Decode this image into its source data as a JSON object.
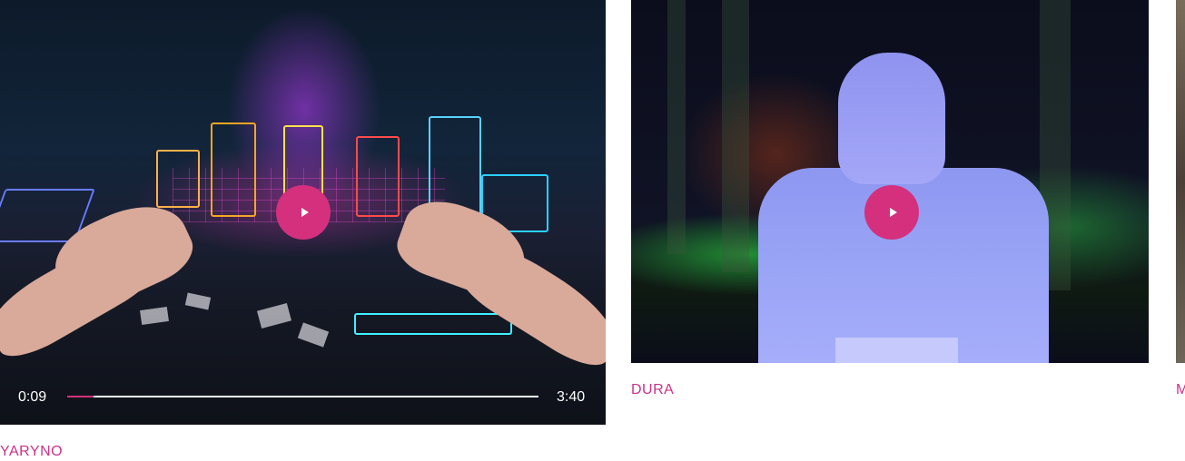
{
  "cards": [
    {
      "title": "YARYNO",
      "player": {
        "current_time": "0:09",
        "duration": "3:40",
        "progress_fraction": 0.055
      }
    },
    {
      "title": "DURA"
    },
    {
      "title": "M"
    }
  ],
  "colors": {
    "accent": "#d4307d",
    "caption": "#c8338a"
  },
  "icons": {
    "play": "play-icon"
  }
}
